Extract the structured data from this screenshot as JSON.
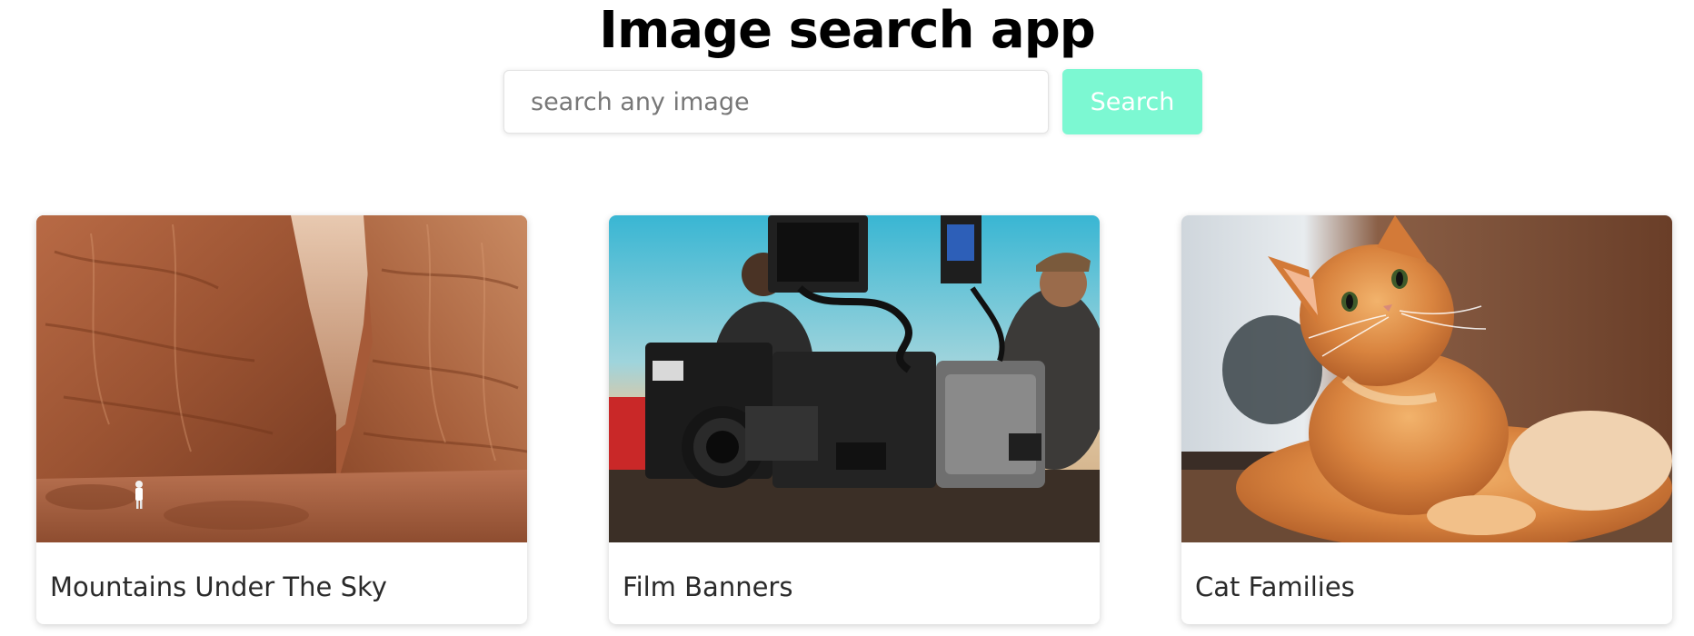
{
  "header": {
    "title": "Image search app"
  },
  "search": {
    "placeholder": "search any image",
    "value": "",
    "button_label": "Search",
    "button_color": "#7cf8d2"
  },
  "results": [
    {
      "title": "Mountains Under The Sky",
      "image": "desert canyon with a person standing at the base of red rock cliffs"
    },
    {
      "title": "Film Banners",
      "image": "RED cinema camera rig with two people in the background"
    },
    {
      "title": "Cat Families",
      "image": "orange long-haired cat lying down and looking up"
    }
  ]
}
